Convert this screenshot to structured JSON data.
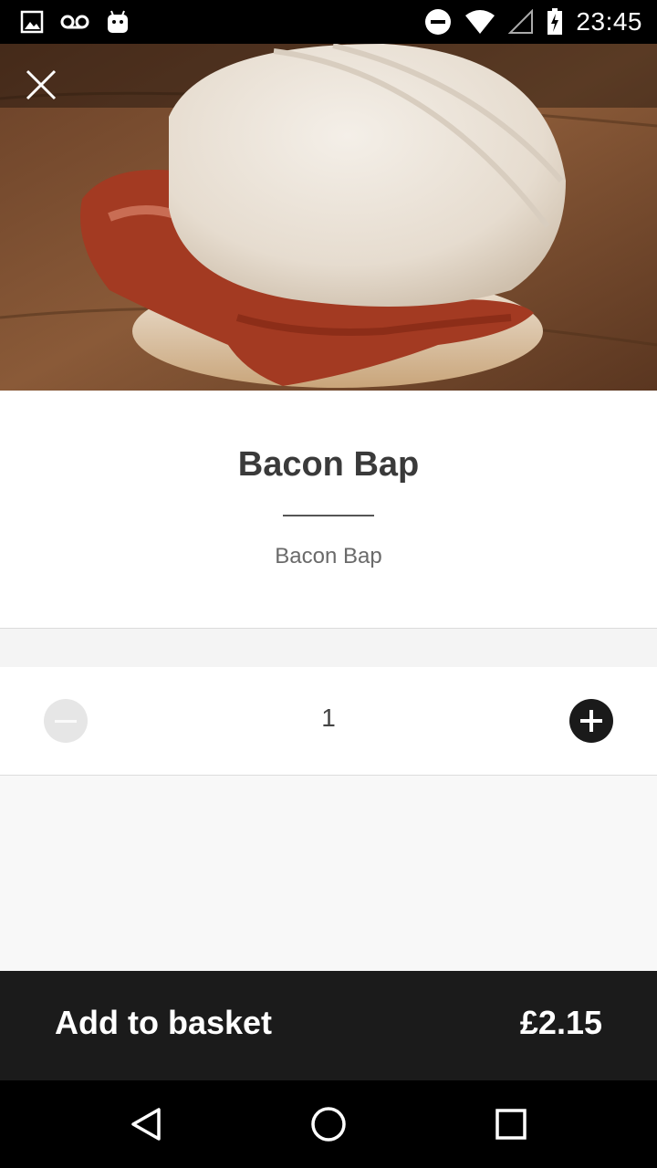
{
  "status_bar": {
    "time": "23:45",
    "left_icons": [
      "image-icon",
      "voicemail-icon",
      "android-icon"
    ],
    "right_icons": [
      "do-not-disturb-icon",
      "wifi-icon",
      "signal-icon",
      "battery-charging-icon"
    ]
  },
  "product": {
    "image": "bacon-bap-photo",
    "title": "Bacon Bap",
    "description": "Bacon Bap"
  },
  "quantity": {
    "value": "1",
    "decrease_icon": "minus-circle-icon",
    "increase_icon": "plus-circle-icon"
  },
  "footer": {
    "add_label": "Add to basket",
    "price": "£2.15"
  },
  "nav": {
    "icons": [
      "back-icon",
      "home-icon",
      "recents-icon"
    ]
  },
  "colors": {
    "bar_bg": "#1b1b1b",
    "title": "#3a3a3a",
    "description": "#6a6a6a",
    "plus_button": "#1a1a1a",
    "minus_button_disabled": "#e6e6e6"
  }
}
